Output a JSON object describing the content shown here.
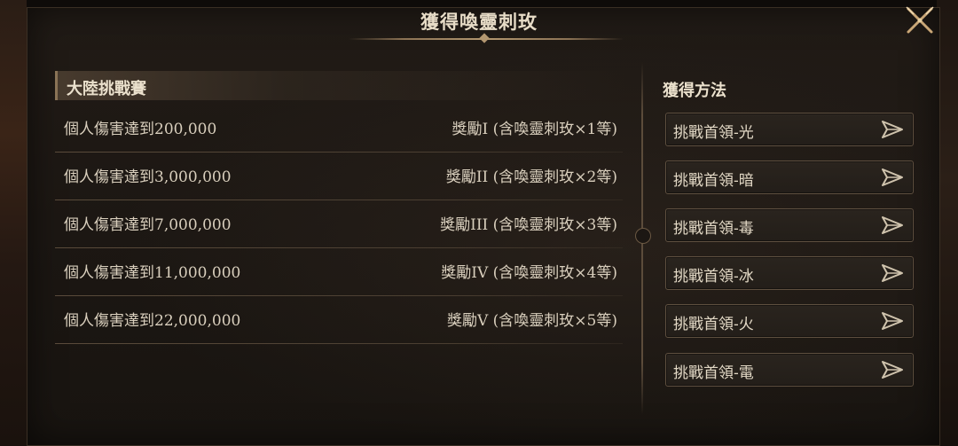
{
  "header": {
    "title": "獲得喚靈刺玫"
  },
  "left": {
    "section_title": "大陸挑戰賽",
    "rows": [
      {
        "condition": "個人傷害達到200,000",
        "reward": "獎勵I (含喚靈刺玫×1等)"
      },
      {
        "condition": "個人傷害達到3,000,000",
        "reward": "獎勵II (含喚靈刺玫×2等)"
      },
      {
        "condition": "個人傷害達到7,000,000",
        "reward": "獎勵III (含喚靈刺玫×3等)"
      },
      {
        "condition": "個人傷害達到11,000,000",
        "reward": "獎勵IV (含喚靈刺玫×4等)"
      },
      {
        "condition": "個人傷害達到22,000,000",
        "reward": "獎勵V (含喚靈刺玫×5等)"
      }
    ]
  },
  "right": {
    "title": "獲得方法",
    "methods": [
      {
        "label": "挑戰首領-光"
      },
      {
        "label": "挑戰首領-暗"
      },
      {
        "label": "挑戰首領-毒"
      },
      {
        "label": "挑戰首領-冰"
      },
      {
        "label": "挑戰首領-火"
      },
      {
        "label": "挑戰首領-電"
      }
    ]
  },
  "icons": {
    "close": "close-x-icon",
    "go": "go-arrow-icon"
  }
}
